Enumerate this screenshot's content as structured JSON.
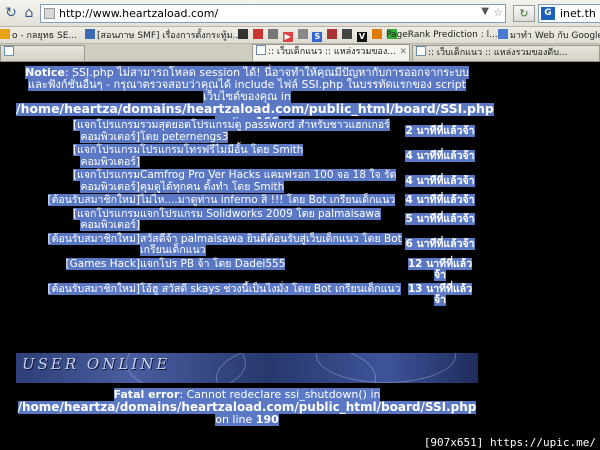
{
  "browser": {
    "url": "http://www.heartzaload.com/",
    "search_text": "inet.th"
  },
  "bookmarks": [
    {
      "label": "o - กลยุทธ SE..."
    },
    {
      "label": "[สอนภาษ SMF] เรื่องการตั้งกระทู้ม..."
    },
    {
      "label": "PageRank Prediction : l..."
    },
    {
      "label": "มาทำ Web กับ Google ..."
    }
  ],
  "tabs": [
    {
      "label": ":: เว็บเด็กแนว :: แหล่งรวมของ..."
    },
    {
      "label": ":: เว็บเด็กแนว :: แหล่งรวมของดีบ..."
    }
  ],
  "notice": {
    "label": "Notice",
    "message": ": SSI.php ไม่สามารถโหลด session ได้! นี่อาจทำให้คุณมีปัญหากับการออกจากระบบและฟังก์ชั่นอื่นๆ - กรุณาตรวจสอบว่าคุณได้ include ไฟล์ SSI.php ในบรรทัดแรกของ script เว็บไซต์ของคุณ in",
    "path": "/home/heartza/domains/heartzaload.com/public_html/board/SSI.php",
    "on_line": "on line",
    "line_no": "166"
  },
  "posts": [
    {
      "category": "[แจกโปรแกรมคอมพิวเตอร์]",
      "title": "รวมสุดยอดโปรแกรมดู password สำหรับชาวแฮกเกอร์ โดย peternengs3",
      "time": "2 นาทีที่แล้วจ้า"
    },
    {
      "category": "[แจกโปรแกรมคอมพิวเตอร์]",
      "title": "โปรแกรมโทรฟรีไม่มีอั้น โดย Smith",
      "time": "4 นาทีที่แล้วจ้า"
    },
    {
      "category": "[แจกโปรแกรมคอมพิวเตอร์]",
      "title": "Camfrog Pro Ver Hacks แคมฟรอก 100 จอ 18 ใจ รัดคุมดูได้ทุกคน ดั้งทำ โดย Smith",
      "time": "4 นาทีที่แล้วจ้า"
    },
    {
      "category": "[ต้อนรับสมาชิกใหม่]",
      "title": "ไม่ไห....มาดูท่าน inferno สิ !!! โดย Bot เกรียนเด็กแนว",
      "time": "4 นาทีที่แล้วจ้า"
    },
    {
      "category": "[แจกโปรแกรมคอมพิวเตอร์]",
      "title": "แจกโปรแกรม Solidworks 2009 โดย palmaisawa",
      "time": "5 นาทีที่แล้วจ้า"
    },
    {
      "category": "[ต้อนรับสมาชิกใหม่]",
      "title": "สวัสดีจ้า palmaisawa ยินดีต้อนรับสู่เว็บเด็กแนว โดย Bot เกรียนเด็กแนว",
      "time": "6 นาทีที่แล้วจ้า"
    },
    {
      "category": "[Games Hack]",
      "title": "แจกโปร PB จ้า โดย Dadei555",
      "time": "12 นาทีที่แล้วจ้า"
    },
    {
      "category": "[ต้อนรับสมาชิกใหม่]",
      "title": "โอ้ฮู สวัสดี skays ช่วงนี้เป็นไงมั่ง โดย Bot เกรียนเด็กแนว",
      "time": "13 นาทีที่แล้วจ้า"
    }
  ],
  "banner": {
    "logo_text": "USER ONLINE"
  },
  "fatal": {
    "label": "Fatal error",
    "message": ": Cannot redeclare ssi_shutdown() in",
    "path": "/home/heartza/domains/heartzaload.com/public_html/board/SSI.php",
    "on_line": "on line",
    "line_no": "190"
  },
  "watermark": "[907x651] https://upic.me/"
}
